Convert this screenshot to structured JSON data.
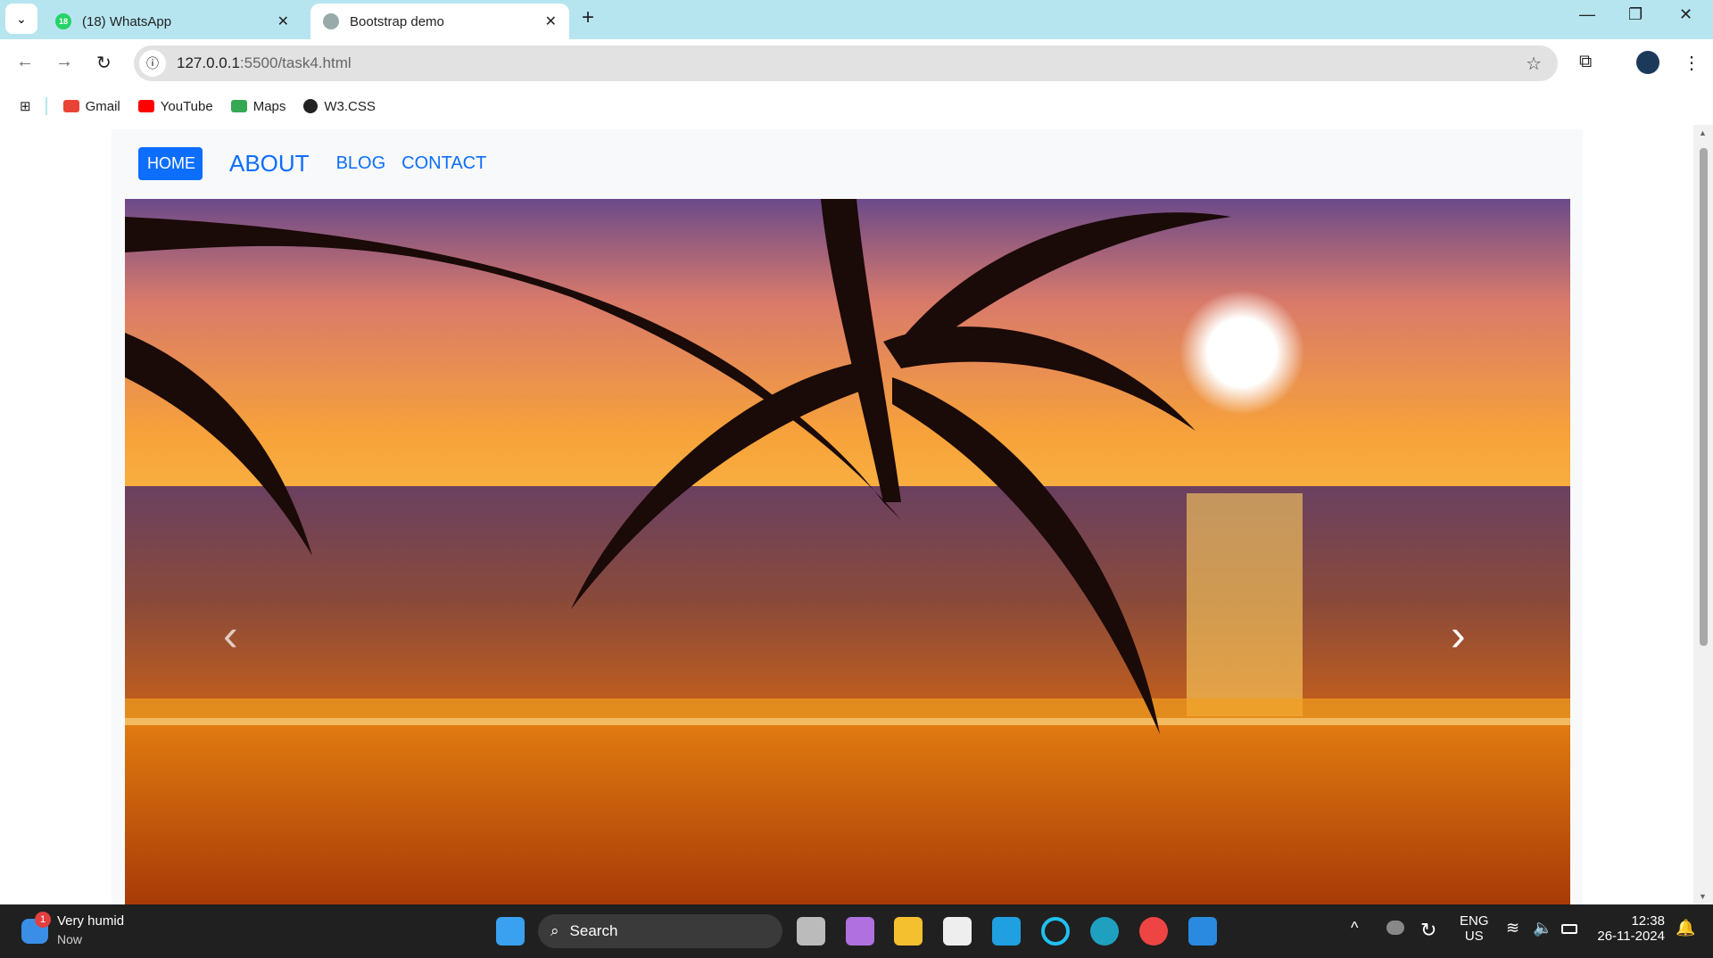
{
  "browser": {
    "tabs": [
      {
        "title": "(18) WhatsApp",
        "badge": "18",
        "active": false
      },
      {
        "title": "Bootstrap demo",
        "active": true
      }
    ],
    "url_host": "127.0.0.1",
    "url_rest": ":5500/task4.html",
    "bookmarks": [
      "Gmail",
      "YouTube",
      "Maps",
      "W3.CSS"
    ]
  },
  "navbar": {
    "items": [
      "HOME",
      "ABOUT",
      "BLOG",
      "CONTACT"
    ],
    "active": "HOME",
    "accent": "#0d6efd"
  },
  "carousel": {
    "prev_icon": "‹",
    "next_icon": "›"
  },
  "taskbar": {
    "weather_title": "Very humid",
    "weather_sub": "Now",
    "weather_badge": "1",
    "search_placeholder": "Search",
    "lang1": "ENG",
    "lang2": "US",
    "time": "12:38",
    "date": "26-11-2024"
  }
}
